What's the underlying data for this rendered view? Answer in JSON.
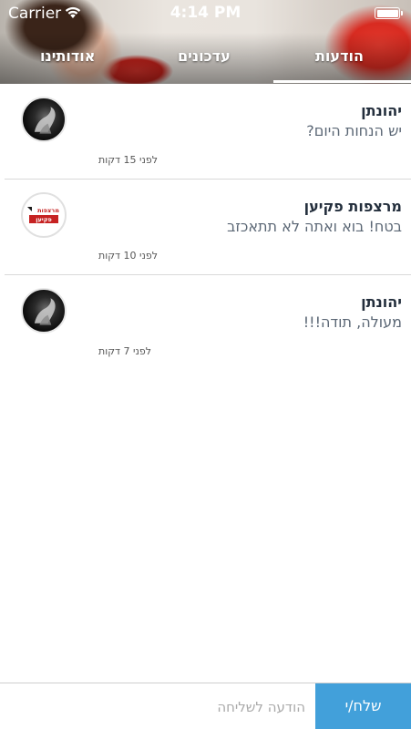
{
  "statusbar": {
    "carrier": "Carrier",
    "time": "4:14 PM"
  },
  "tabs": {
    "messages": "הודעות",
    "updates": "עדכונים",
    "about": "אודותינו"
  },
  "messages": [
    {
      "name": "יהונתן",
      "text": "יש הנחות היום?",
      "time": "לפני 15 דקות",
      "avatar": "person-dark"
    },
    {
      "name": "מרצפות פקיען",
      "text": "בטח! בוא ואתה לא תתאכזב",
      "time": "לפני 10 דקות",
      "avatar": "company-logo",
      "logo_text": [
        "מרצפות",
        "פקיען"
      ]
    },
    {
      "name": "יהונתן",
      "text": "מעולה, תודה!!!",
      "time": "לפני 7 דקות",
      "avatar": "person-dark"
    }
  ],
  "composer": {
    "placeholder": "הודעה לשליחה",
    "send_label": "שלח/י"
  },
  "colors": {
    "accent": "#42a0da",
    "name_text": "#232e3c",
    "body_text": "#5b6775"
  }
}
